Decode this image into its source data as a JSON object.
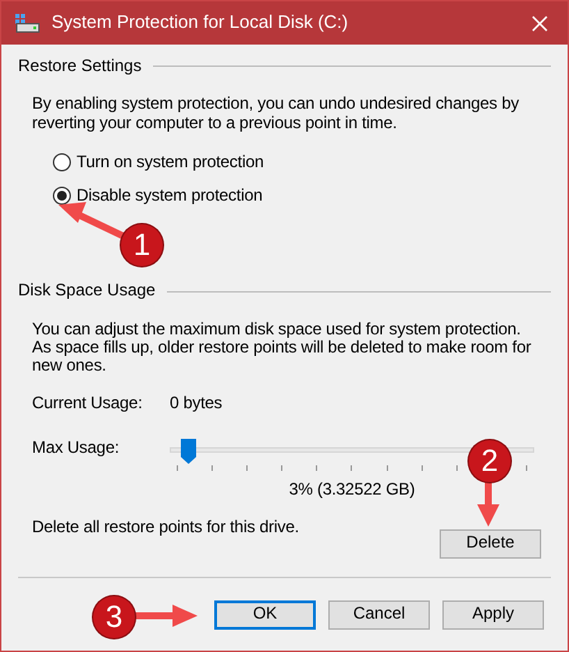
{
  "window": {
    "title": "System Protection for Local Disk (C:)"
  },
  "restore_settings": {
    "heading": "Restore Settings",
    "description": "By enabling system protection, you can undo undesired changes by reverting your computer to a previous point in time.",
    "options": [
      {
        "label": "Turn on system protection",
        "selected": false
      },
      {
        "label": "Disable system protection",
        "selected": true
      }
    ]
  },
  "disk_space_usage": {
    "heading": "Disk Space Usage",
    "description": "You can adjust the maximum disk space used for system protection. As space fills up, older restore points will be deleted to make room for new ones.",
    "current_usage_label": "Current Usage:",
    "current_usage_value": "0 bytes",
    "max_usage_label": "Max Usage:",
    "max_usage": {
      "level": 0.03
    },
    "max_usage_reading": "3% (3.32522 GB)",
    "delete_text": "Delete all restore points for this drive.",
    "delete_button": "Delete"
  },
  "buttons": [
    {
      "label": "OK",
      "default": true
    },
    {
      "label": "Cancel",
      "default": false
    },
    {
      "label": "Apply",
      "default": false
    }
  ],
  "annotations": [
    {
      "number": "1"
    },
    {
      "number": "2"
    },
    {
      "number": "3"
    }
  ]
}
